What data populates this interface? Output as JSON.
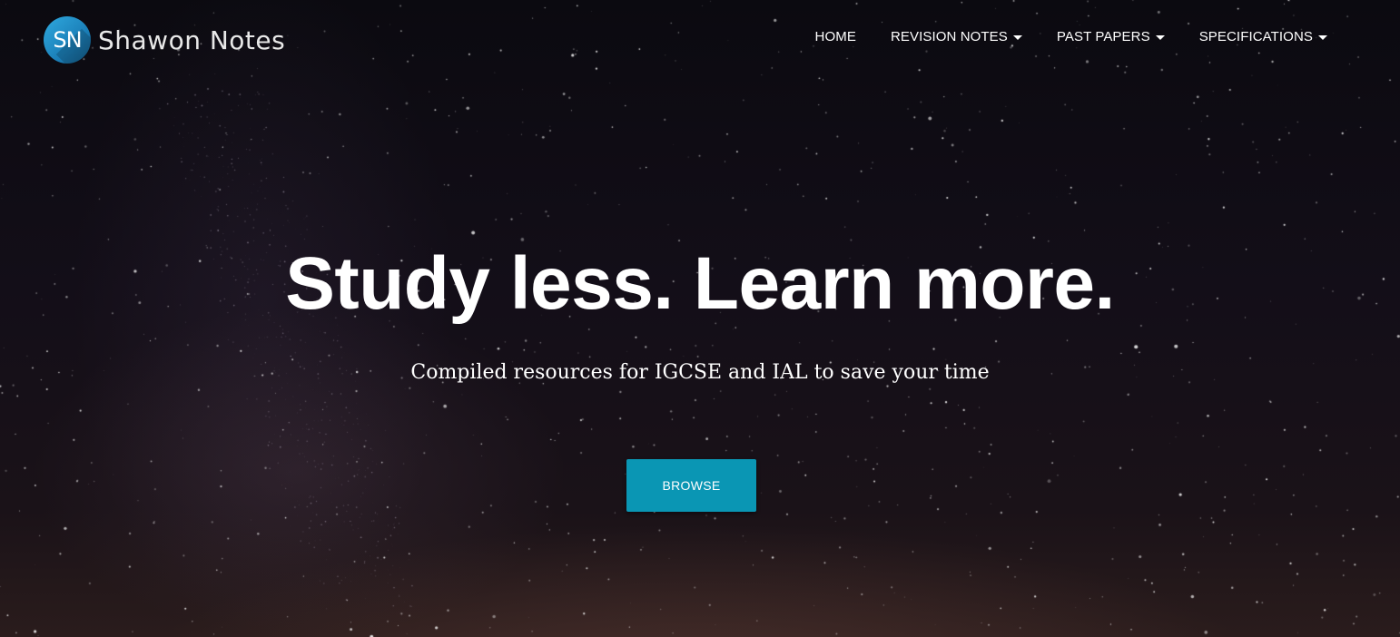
{
  "brand": {
    "initials": "SN",
    "name": "Shawon Notes",
    "badge_color": "#2fa9df"
  },
  "nav": {
    "items": [
      {
        "label": "HOME",
        "dropdown": false
      },
      {
        "label": "REVISION NOTES",
        "dropdown": true
      },
      {
        "label": "PAST PAPERS",
        "dropdown": true
      },
      {
        "label": "SPECIFICATIONS",
        "dropdown": true
      }
    ]
  },
  "hero": {
    "headline": "Study less. Learn more.",
    "subheadline": "Compiled resources for IGCSE and IAL to save your time",
    "cta_label": "BROWSE",
    "cta_color": "#0a96b4",
    "background": "night-sky-stars"
  }
}
